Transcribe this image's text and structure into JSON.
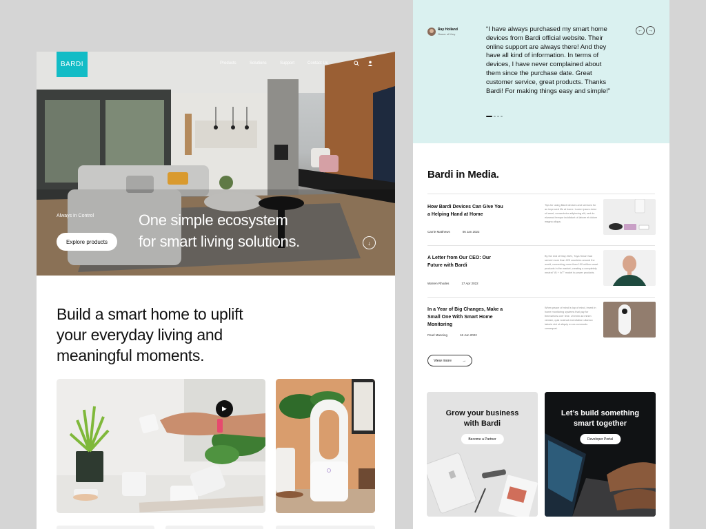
{
  "brand": {
    "logo": "BARDI",
    "accent": "#12bcc6"
  },
  "nav": {
    "items": [
      "Products",
      "Solutions",
      "Support",
      "Contact Us"
    ],
    "search_icon": "search-icon",
    "user_icon": "user-icon"
  },
  "hero": {
    "tagline": "Always in Control",
    "title_line1": "One simple ecosystem",
    "title_line2": "for smart living solutions.",
    "cta": "Explore products",
    "scroll_icon": "arrow-down-icon"
  },
  "intro": {
    "line1": "Build a smart home to uplift",
    "line2": "your everyday living and",
    "line3": "meaningful moments."
  },
  "testimonial": {
    "name": "Ray Holland",
    "role": "Owner of Kmy",
    "quote": "“I have always purchased my smart home devices from Bardi official website. Their online support are always there! And they have all kind of information. In terms of devices, I have never complained about them since the purchase date. Great customer service, great products. Thanks Bardi! For making things easy and simple!”",
    "prev_icon": "arrow-left-icon",
    "next_icon": "arrow-right-icon",
    "slides": 4,
    "active_slide": 1
  },
  "media": {
    "title": "Bardi in Media.",
    "articles": [
      {
        "title": "How Bardi Devices Can Give You a Helping Hand at Home",
        "author": "Carrie Matthews",
        "date": "06 Jan 2022",
        "desc": "Tips for using Bardi devices and services for an improved life at home. Lorem ipsum dolor sit amet, consectetur adipiscing elit, sed do eiusmod tempor incididunt ut labore et dolore magna aliqua."
      },
      {
        "title": "A Letter from Our CEO: Our Future with Bardi",
        "author": "Warren Rhodes",
        "date": "17 Apr 2022",
        "desc": "By the end of May 2021, Tuya Smart had served more than 223 countries around the world, connecting more than 100 million smart products in the market, creating a completely neutral \"AI + IoT\" model to power products."
      },
      {
        "title": "In a Year of Big Changes, Make a Small One With Smart Home Monitoring",
        "author": "Pearl Manning",
        "date": "16 Jun 2022",
        "desc": "When peace of mind is top of mind, invest in home monitoring systems that pay for themselves over time. Ut enim ad minim veniam, quis nostrud exercitation ullamco laboris nisi ut aliquip ex ea commodo consequat."
      }
    ],
    "view_more": "View more"
  },
  "cta_cards": [
    {
      "title_line1": "Grow your business",
      "title_line2": "with Bardi",
      "button": "Become a Partner"
    },
    {
      "title_line1": "Let’s build something",
      "title_line2": "smart together",
      "button": "Developer Portal"
    }
  ]
}
